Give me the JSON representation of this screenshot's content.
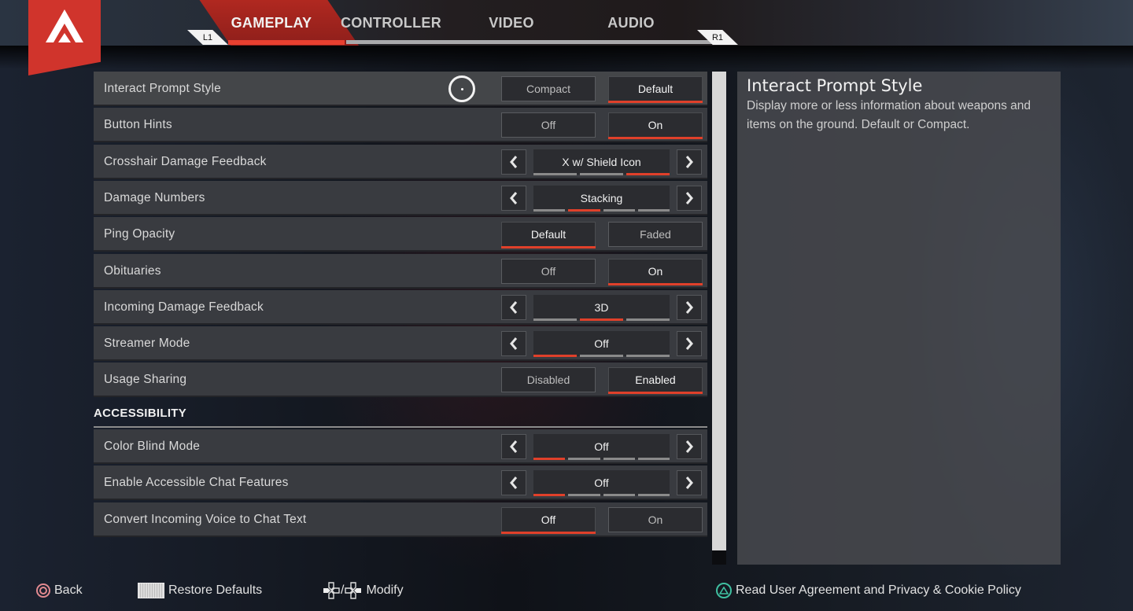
{
  "header": {
    "logo": "apex-legends-logo",
    "bumper_left": "L1",
    "bumper_right": "R1",
    "tabs": [
      {
        "label": "GAMEPLAY",
        "active": true
      },
      {
        "label": "CONTROLLER",
        "active": false
      },
      {
        "label": "VIDEO",
        "active": false
      },
      {
        "label": "AUDIO",
        "active": false
      }
    ]
  },
  "settings": [
    {
      "label": "Interact Prompt Style",
      "type": "toggle",
      "options": [
        "Compact",
        "Default"
      ],
      "selected": "Default"
    },
    {
      "label": "Button Hints",
      "type": "toggle",
      "options": [
        "Off",
        "On"
      ],
      "selected": "On"
    },
    {
      "label": "Crosshair Damage Feedback",
      "type": "carousel",
      "value": "X w/ Shield Icon",
      "pip_count": 3,
      "pip_index": 3
    },
    {
      "label": "Damage Numbers",
      "type": "carousel",
      "value": "Stacking",
      "pip_count": 4,
      "pip_index": 2
    },
    {
      "label": "Ping Opacity",
      "type": "toggle",
      "options": [
        "Default",
        "Faded"
      ],
      "selected": "Default"
    },
    {
      "label": "Obituaries",
      "type": "toggle",
      "options": [
        "Off",
        "On"
      ],
      "selected": "On"
    },
    {
      "label": "Incoming Damage Feedback",
      "type": "carousel",
      "value": "3D",
      "pip_count": 3,
      "pip_index": 2
    },
    {
      "label": "Streamer Mode",
      "type": "carousel",
      "value": "Off",
      "pip_count": 3,
      "pip_index": 1
    },
    {
      "label": "Usage Sharing",
      "type": "toggle",
      "options": [
        "Disabled",
        "Enabled"
      ],
      "selected": "Enabled"
    }
  ],
  "accessibility": {
    "heading": "ACCESSIBILITY",
    "settings": [
      {
        "label": "Color Blind Mode",
        "type": "carousel",
        "value": "Off",
        "pip_count": 4,
        "pip_index": 1
      },
      {
        "label": "Enable Accessible Chat Features",
        "type": "carousel",
        "value": "Off",
        "pip_count": 4,
        "pip_index": 1
      },
      {
        "label": "Convert Incoming Voice to Chat Text",
        "type": "toggle",
        "options": [
          "Off",
          "On"
        ],
        "selected": "Off"
      }
    ]
  },
  "description": {
    "title": "Interact Prompt Style",
    "body": "Display more or less information about weapons and items on the ground.  Default or Compact."
  },
  "footer": {
    "back": "Back",
    "restore": "Restore Defaults",
    "modify_sep": "/",
    "modify": "Modify",
    "agreement": "Read User Agreement and Privacy & Cookie Policy"
  },
  "colors": {
    "accent": "#e0402a",
    "logo_red": "#d0342c",
    "triangle_button": "#3fbfa0",
    "circle_button": "#e28a90"
  }
}
